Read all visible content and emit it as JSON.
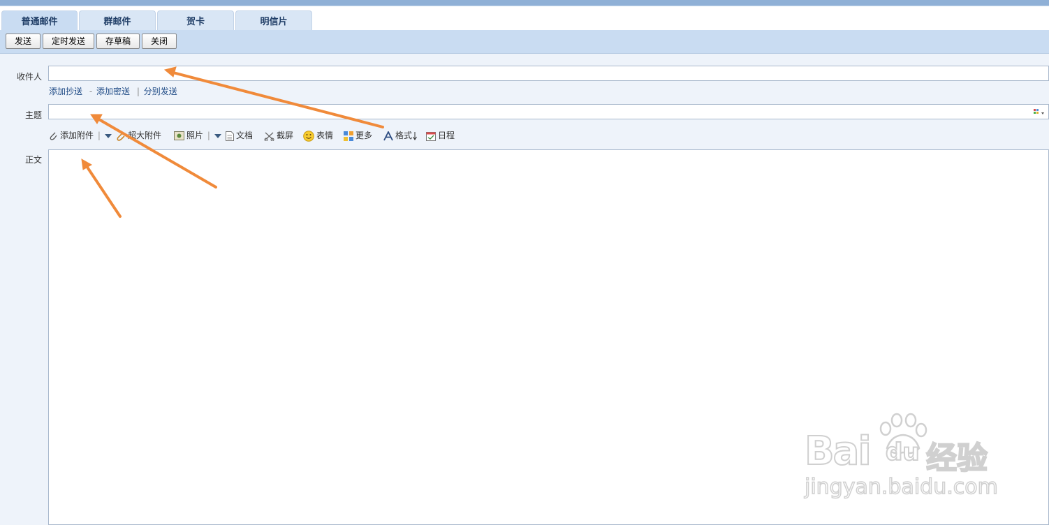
{
  "tabs": [
    {
      "label": "普通邮件",
      "active": true
    },
    {
      "label": "群邮件",
      "active": false
    },
    {
      "label": "贺卡",
      "active": false
    },
    {
      "label": "明信片",
      "active": false
    }
  ],
  "toolbar": {
    "send_label": "发送",
    "scheduled_send_label": "定时发送",
    "save_draft_label": "存草稿",
    "close_label": "关闭"
  },
  "form": {
    "recipient_label": "收件人",
    "recipient_value": "",
    "add_cc_label": "添加抄送",
    "add_bcc_label": "添加密送",
    "separate_send_label": "分别发送",
    "link_separator_1": "-",
    "link_separator_2": "|",
    "subject_label": "主题",
    "subject_value": "",
    "body_label": "正文",
    "body_value": ""
  },
  "attach_toolbar": {
    "add_attachment_label": "添加附件",
    "large_attachment_label": "超大附件",
    "photo_label": "照片",
    "document_label": "文档",
    "screenshot_label": "截屏",
    "emoji_label": "表情",
    "more_label": "更多",
    "format_label": "格式",
    "calendar_label": "日程"
  },
  "watermark": {
    "brand": "Bai",
    "brand_du": "du",
    "brand_cn": "经验",
    "url": "jingyan.baidu.com"
  },
  "colors": {
    "annotation_arrow": "#f08a3a",
    "tab_bg": "#d9e6f5",
    "toolbar_bg": "#c9dcf2",
    "form_bg": "#eef3fa"
  }
}
